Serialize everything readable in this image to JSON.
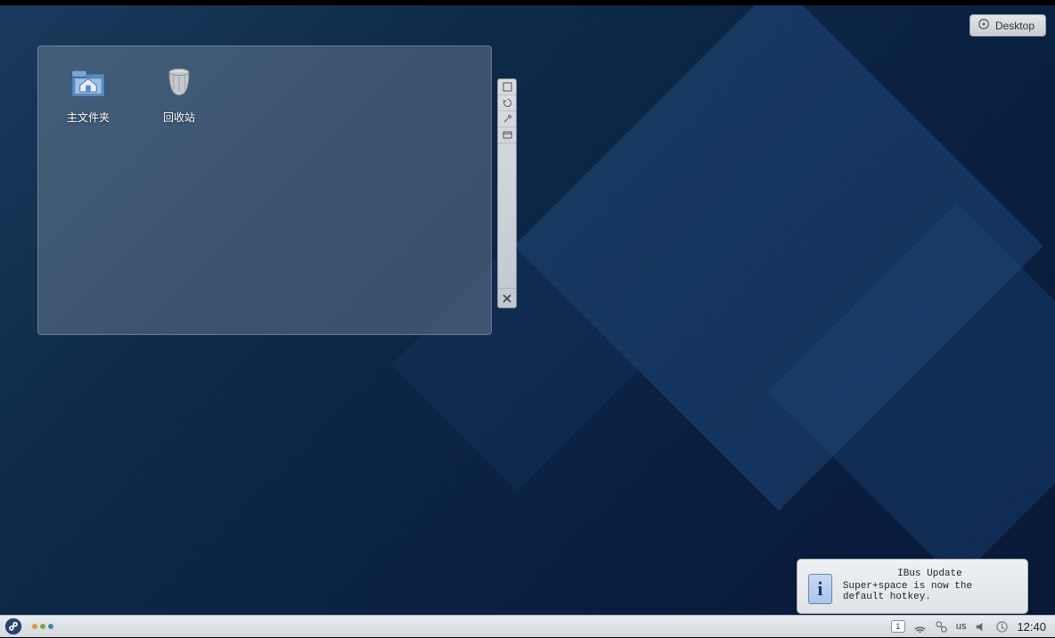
{
  "toolbox": {
    "label": "Desktop"
  },
  "folder_widget": {
    "items": [
      {
        "label": "主文件夹"
      },
      {
        "label": "回收站"
      }
    ]
  },
  "notification": {
    "title": "IBus Update",
    "body": "Super+space is now the default hotkey."
  },
  "systray": {
    "notify_count": "1",
    "keyboard_layout": "us",
    "clock": "12:40"
  }
}
